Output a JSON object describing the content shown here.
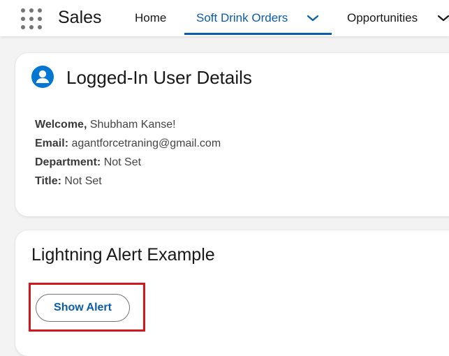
{
  "header": {
    "app_name": "Sales",
    "nav": {
      "home": "Home",
      "soft_drink_orders": "Soft Drink Orders",
      "opportunities": "Opportunities"
    }
  },
  "user_card": {
    "title": "Logged-In User Details",
    "welcome_label": "Welcome,",
    "welcome_value": "Shubham Kanse!",
    "email_label": "Email:",
    "email_value": "agantforcetraning@gmail.com",
    "department_label": "Department:",
    "department_value": "Not Set",
    "title_label": "Title:",
    "title_value": "Not Set"
  },
  "alert_card": {
    "title": "Lightning Alert Example",
    "button_label": "Show Alert"
  },
  "colors": {
    "brand_blue": "#0b5cab",
    "icon_blue": "#0176d3",
    "highlight_red": "#d2161c",
    "background": "#f3f3f3"
  },
  "icons": [
    "app-launcher-icon",
    "chevron-down-icon",
    "user-avatar-icon"
  ]
}
